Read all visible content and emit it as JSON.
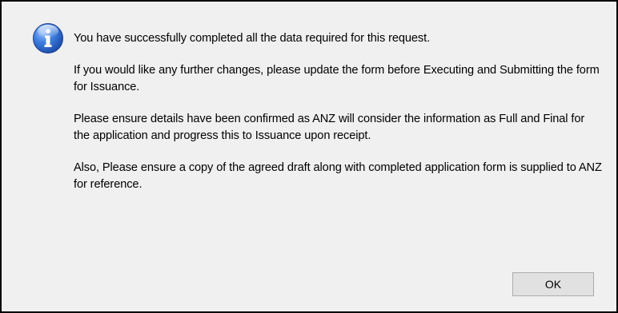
{
  "dialog": {
    "icon": "information-icon",
    "messages": [
      "You have successfully completed all the data required for this request.",
      "If you would like any further changes, please update the form before Executing and Submitting the form for Issuance.",
      "Please ensure details have been confirmed as ANZ will consider the information as Full and Final for the application and progress this to Issuance upon receipt.",
      "Also, Please ensure a copy of the agreed draft along with completed application form is supplied to ANZ for reference."
    ],
    "ok_label": "OK"
  },
  "colors": {
    "dialog_background": "#f0f0f0",
    "border": "#000000",
    "icon_blue": "#2f6fd0",
    "button_background": "#e1e1e1",
    "button_border": "#adadad"
  }
}
